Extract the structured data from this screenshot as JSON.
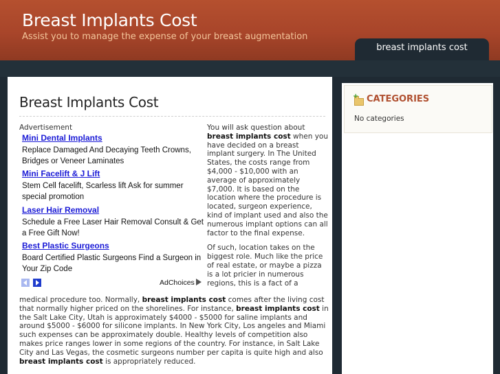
{
  "site": {
    "title": "Breast Implants Cost",
    "tagline": "Assist you to manage the expense of your breast augmentation"
  },
  "nav": {
    "tab_label": "breast implants cost"
  },
  "post": {
    "title": "Breast Implants Cost",
    "p1": [
      "You will ask question about ",
      "breast implants cost",
      " when you have decided on a breast implant surgery. In The United States, the costs range from $4,000 - $10,000 with an average of approximately $7,000. It is based on the location where the procedure is located, surgeon experience, kind of implant used and also the numerous implant options can all factor to the final expense."
    ],
    "p2_top": "Of such, location takes on the biggest role. Much like the price of real estate, or maybe a pizza is a lot pricier in numerous regions, this is a fact of a",
    "p2_bottom": [
      "medical procedure too. Normally, ",
      "breast implants cost",
      " comes after the living cost that normally higher priced on the shorelines. For instance, ",
      "breast implants cost",
      " in the Salt Lake City, Utah is approximately $4000 - $5000 for saline implants and around $5000 - $6000 for silicone implants. In New York City, Los angeles and Miami such expenses can be approximately double. Healthy levels of competition also makes price ranges lower in some regions of the country. For instance, in Salt Lake City and Las Vegas, the cosmetic surgeons number per capita is quite high and also ",
      "breast implants cost",
      " is appropriately reduced."
    ]
  },
  "ads": {
    "label": "Advertisement",
    "items": [
      {
        "title": "Mini Dental Implants",
        "desc": "Replace Damaged And Decaying Teeth Crowns, Bridges or Veneer Laminates"
      },
      {
        "title": "Mini Facelift & J Lift",
        "desc": "Stem Cell facelift, Scarless lift Ask for summer special promotion"
      },
      {
        "title": "Laser Hair Removal",
        "desc": "Schedule a Free Laser Hair Removal Consult & Get a Free Gift Now!"
      },
      {
        "title": "Best Plastic Surgeons",
        "desc": "Board Certified Plastic Surgeons Find a Surgeon in Your Zip Code"
      }
    ],
    "adchoices_label": "AdChoices"
  },
  "sidebar": {
    "categories_title": "CATEGORIES",
    "categories_empty": "No categories",
    "icon": "folder-add-icon"
  },
  "colors": {
    "header": "#a8452a",
    "tagline": "#f4c69b",
    "background": "#1f2a33",
    "ad_link": "#1a1ad6",
    "category_title": "#b05030"
  }
}
